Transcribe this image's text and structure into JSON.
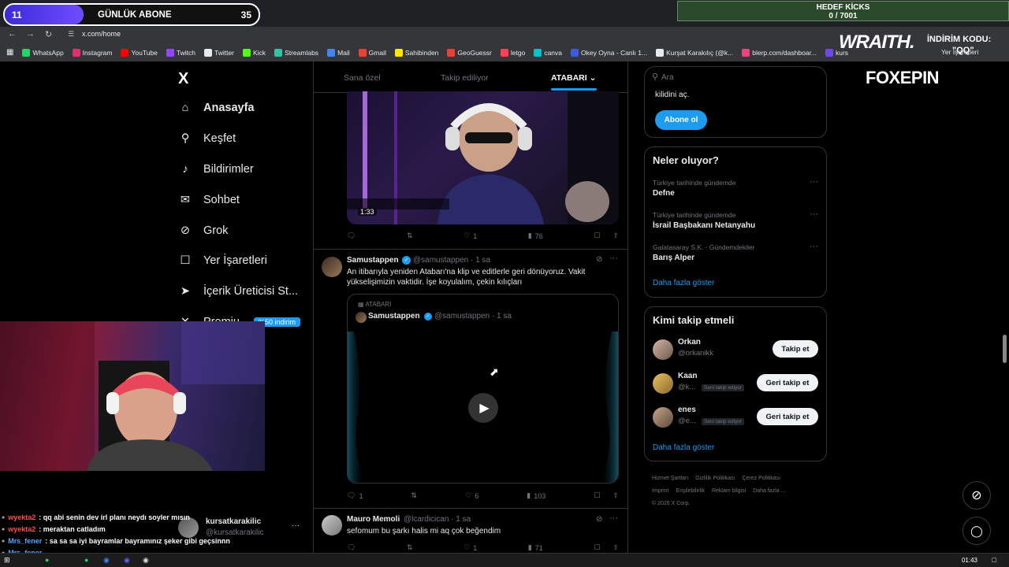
{
  "overlay": {
    "sub_left": "11",
    "sub_title": "GÜNLÜK ABONE",
    "sub_right": "35",
    "sub_progress": 0.31,
    "kicks_title": "HEDEF KİCKS",
    "kicks_value": "0 / 7001",
    "wraith": "WRAITH.",
    "discount_label": "İNDİRİM KODU:",
    "discount_code": "\"QQ\"",
    "foxepin": "FOXEPIN"
  },
  "browser": {
    "url": "x.com/home",
    "bookmarks": [
      {
        "label": "WhatsApp",
        "color": "#25d366"
      },
      {
        "label": "Instagram",
        "color": "#e1306c"
      },
      {
        "label": "YouTube",
        "color": "#ff0000"
      },
      {
        "label": "Twitch",
        "color": "#9146ff"
      },
      {
        "label": "Twitter",
        "color": "#e8eaed"
      },
      {
        "label": "Kick",
        "color": "#53fc18"
      },
      {
        "label": "Streamlabs",
        "color": "#31c3a2"
      },
      {
        "label": "Mail",
        "color": "#4285f4"
      },
      {
        "label": "Gmail",
        "color": "#ea4335"
      },
      {
        "label": "Sahibinden",
        "color": "#ffe800"
      },
      {
        "label": "GeoGuessr",
        "color": "#ea4335"
      },
      {
        "label": "letgo",
        "color": "#ff3f55"
      },
      {
        "label": "canva",
        "color": "#00c4cc"
      },
      {
        "label": "Okey Oyna - Canlı 1...",
        "color": "#3b5bdb"
      },
      {
        "label": "Kurşat Karakılıç (@k...",
        "color": "#e8eaed"
      },
      {
        "label": "blerp.com/dashboar...",
        "color": "#e8457c"
      },
      {
        "label": "kurs",
        "color": "#7048e8"
      }
    ],
    "bookmarks_folder": "Yer İşaretleri"
  },
  "x": {
    "logo": "X",
    "nav": [
      {
        "label": "Anasayfa",
        "icon": "home-icon"
      },
      {
        "label": "Keşfet",
        "icon": "search-icon"
      },
      {
        "label": "Bildirimler",
        "icon": "bell-icon"
      },
      {
        "label": "Sohbet",
        "icon": "mail-icon"
      },
      {
        "label": "Grok",
        "icon": "grok-icon"
      },
      {
        "label": "Yer İşaretleri",
        "icon": "bookmark-icon"
      },
      {
        "label": "İçerik Üreticisi St...",
        "icon": "rocket-icon"
      },
      {
        "label": "Premiu",
        "icon": "x-icon"
      }
    ],
    "premium_badge": "%50 indirim",
    "account": {
      "name": "kursatkarakilic",
      "handle": "@kursatkarakilic"
    },
    "tabs": [
      "Sana özel",
      "Takip ediliyor",
      "ATABARI"
    ],
    "tweet1": {
      "duration": "1:33",
      "replies": "",
      "reposts": "",
      "likes": "1",
      "views": "76"
    },
    "tweet2": {
      "name": "Samustappen",
      "handle": "@samustappen · 1 sa",
      "text": "An itibarıyla yeniden Atabarı'na klip ve editlerle geri dönüyoruz. Vakit yükselişimizin vaktidir. İşe koyulalım, çekin kılıçları",
      "quote_community": "ATABARI",
      "quote_name": "Samustappen",
      "quote_handle": "@samustappen · 1 sa",
      "replies": "1",
      "likes": "6",
      "views": "103"
    },
    "tweet3": {
      "name": "Mauro Memoli",
      "handle": "@lcardicican · 1 sa",
      "text": "sefomum bu şarkı halis mi aq çok beğendim",
      "likes": "1",
      "views": "71"
    },
    "search_placeholder": "Ara",
    "premium_card": {
      "text": "kilidini aç.",
      "button": "Abone ol"
    },
    "trends": {
      "title": "Neler oluyor?",
      "items": [
        {
          "meta": "Türkiye tarihinde gündemde",
          "name": "Defne"
        },
        {
          "meta": "Türkiye tarihinde gündemde",
          "name": "İsrail Başbakanı Netanyahu"
        },
        {
          "meta": "Galatasaray S.K. · Gündemdekiler",
          "name": "Barış Alper"
        }
      ],
      "more": "Daha fazla göster"
    },
    "who_to_follow": {
      "title": "Kimi takip etmeli",
      "items": [
        {
          "name": "Orkan",
          "handle": "@orkanikk",
          "badge": "",
          "button": "Takip et"
        },
        {
          "name": "Kaan",
          "handle": "@k...",
          "badge": "Seni takip ediyor",
          "button": "Geri takip et"
        },
        {
          "name": "enes",
          "handle": "@e...",
          "badge": "Seni takip ediyor",
          "button": "Geri takip et"
        }
      ],
      "more": "Daha fazla göster"
    },
    "footer": [
      "Hizmet Şartları",
      "Gizlilik Politikası",
      "Çerez Politikası",
      "Imprint",
      "Erişilebilirlik",
      "Reklam bilgisi",
      "Daha fazla ...",
      "© 2026 X Corp."
    ]
  },
  "chat": [
    {
      "user": "wyekta2",
      "color": "#ff4d4d",
      "msg": "qq abi senin dev irl planı neydı soyler mısın"
    },
    {
      "user": "wyekta2",
      "color": "#ff4d4d",
      "msg": "meraktan catladım"
    },
    {
      "user": "Mrs_fener",
      "color": "#4da6ff",
      "msg": "sa sa sa iyi bayramlar bayramınız şeker gibi geçsinnn"
    },
    {
      "user": "Mrs_fener",
      "color": "#4da6ff",
      "msg": ""
    }
  ],
  "taskbar": {
    "clock": "01:43"
  }
}
